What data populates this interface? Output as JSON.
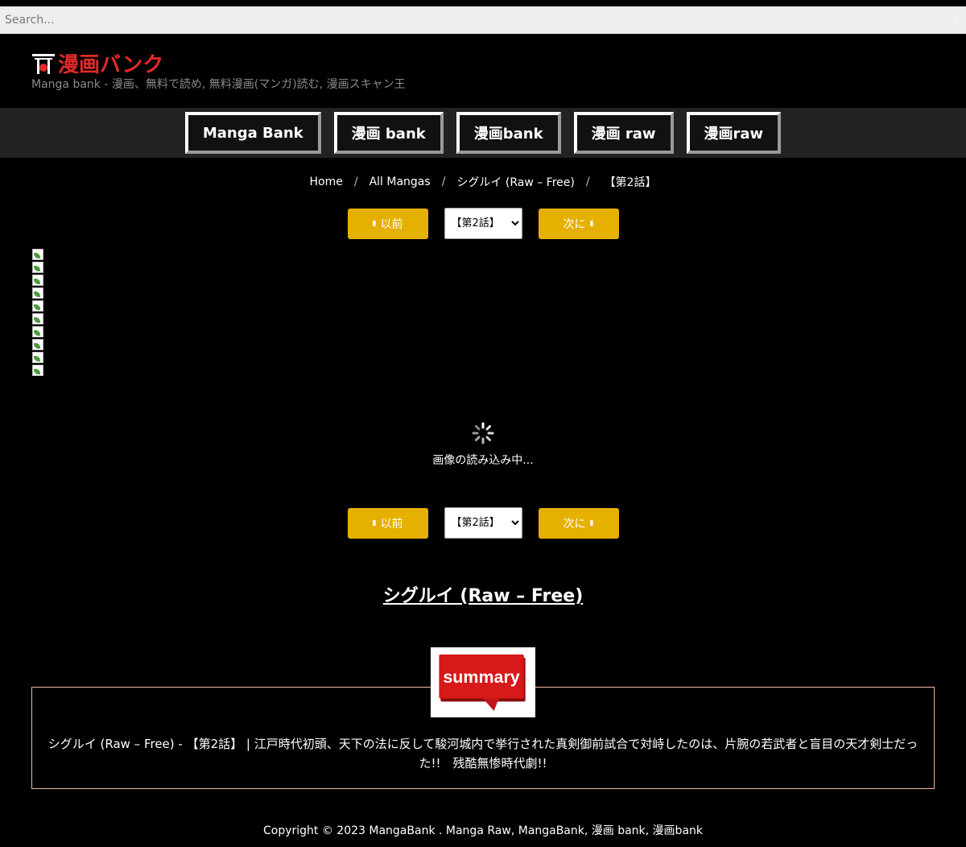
{
  "search": {
    "placeholder": "Search..."
  },
  "header": {
    "logo_text": "漫画バンク",
    "tagline": "Manga bank - 漫画、無料で読め, 無料漫画(マンガ)読む, 漫画スキャン王"
  },
  "nav": {
    "items": [
      {
        "label": "Manga Bank"
      },
      {
        "label": "漫画 bank"
      },
      {
        "label": "漫画bank"
      },
      {
        "label": "漫画 raw"
      },
      {
        "label": "漫画raw"
      }
    ]
  },
  "breadcrumb": {
    "items": [
      "Home",
      "All Mangas",
      "シグルイ (Raw – Free)",
      "【第2話】"
    ]
  },
  "chapter_nav": {
    "prev_label": "以前",
    "next_label": "次に",
    "selected_chapter": "【第2話】"
  },
  "loader": {
    "text": "画像の読み込み中..."
  },
  "manga": {
    "title": "シグルイ (Raw – Free)"
  },
  "summary": {
    "badge": "summary",
    "text": "シグルイ (Raw – Free) - 【第2話】 | 江戸時代初頭、天下の法に反して駿河城内で挙行された真剣御前試合で対峙したのは、片腕の若武者と盲目の天才剣士だった!!　残酷無惨時代劇!!"
  },
  "footer": {
    "text": "Copyright © 2023 MangaBank . Manga Raw, MangaBank, 漫画 bank, 漫画bank"
  },
  "colors": {
    "logo_red": "#e22a2a",
    "button_gold": "#e6b000",
    "summary_border": "#f0b9a3",
    "nav_bg": "#222222"
  }
}
